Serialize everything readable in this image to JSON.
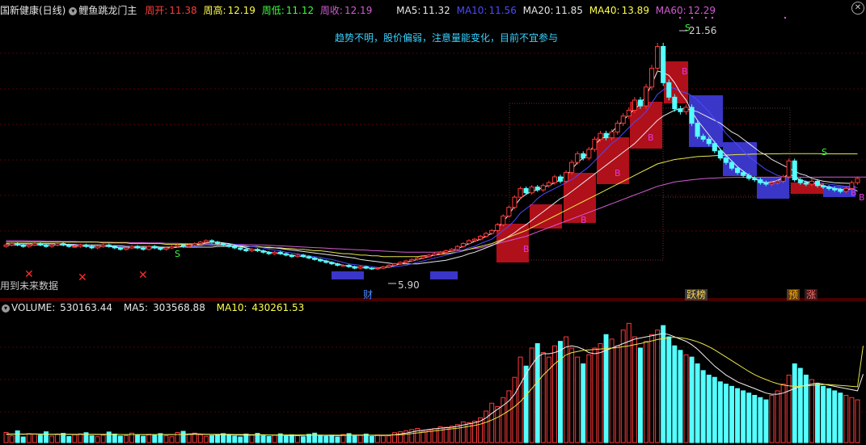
{
  "header": {
    "title": "国新健康(日线)",
    "indicator_name": "鲤鱼跳龙门主",
    "stats": [
      {
        "label": "周开:",
        "value": "11.38",
        "color": "#ff3a3a"
      },
      {
        "label": "周高:",
        "value": "12.19",
        "color": "#ffff4a"
      },
      {
        "label": "周低:",
        "value": "11.12",
        "color": "#3aff3a"
      },
      {
        "label": "周收:",
        "value": "12.19",
        "color": "#d35bd3"
      }
    ],
    "ma": [
      {
        "label": "MA5:",
        "value": "11.32",
        "color": "#e6e6e6"
      },
      {
        "label": "MA10:",
        "value": "11.56",
        "color": "#4a4aff"
      },
      {
        "label": "MA20:",
        "value": "11.85",
        "color": "#e6e6e6"
      },
      {
        "label": "MA40:",
        "value": "13.89",
        "color": "#ffff4a"
      },
      {
        "label": "MA60:",
        "value": "12.29",
        "color": "#d35bd3"
      }
    ]
  },
  "notes": {
    "advice": "趋势不明，股价偏弱，注意量能变化，目前不宜参与",
    "future_data": "用到未来数据",
    "high_label": "21.56",
    "low_label": "5.90"
  },
  "events": [
    {
      "text": "财",
      "color": "#4a8cff",
      "bg": "#2a2a2a"
    },
    {
      "text": "跃榜",
      "color": "#ffd24a",
      "bg": "#3a3a3a"
    },
    {
      "text": "预",
      "color": "#ffb400",
      "bg": "#5a3a1a"
    },
    {
      "text": "涨",
      "color": "#ff6a6a",
      "bg": "#3a1a1a"
    }
  ],
  "volume_header": {
    "label": "VOLUME:",
    "value": "530163.44",
    "ma5_label": "MA5:",
    "ma5_value": "303568.88",
    "ma10_label": "MA10:",
    "ma10_value": "430261.53"
  },
  "chart_data": {
    "type": "candlestick",
    "price_high": 21.56,
    "price_low": 5.9,
    "closes": [
      7.6,
      7.7,
      7.6,
      7.5,
      7.6,
      7.7,
      7.6,
      7.5,
      7.6,
      7.7,
      7.6,
      7.5,
      7.5,
      7.6,
      7.5,
      7.4,
      7.5,
      7.6,
      7.5,
      7.4,
      7.3,
      7.4,
      7.5,
      7.4,
      7.3,
      7.5,
      7.4,
      7.3,
      7.4,
      7.5,
      7.6,
      7.5,
      7.6,
      7.7,
      7.8,
      7.9,
      7.8,
      7.7,
      7.6,
      7.5,
      7.4,
      7.3,
      7.2,
      7.3,
      7.2,
      7.1,
      7.0,
      7.1,
      7.0,
      6.9,
      6.8,
      6.9,
      6.8,
      6.7,
      6.6,
      6.5,
      6.4,
      6.3,
      6.2,
      6.2,
      6.1,
      6.0,
      6.1,
      6.0,
      5.95,
      6.0,
      6.1,
      6.2,
      6.3,
      6.4,
      6.5,
      6.6,
      6.7,
      6.8,
      6.9,
      7.0,
      7.1,
      7.2,
      7.3,
      7.5,
      7.7,
      7.9,
      8.0,
      8.2,
      8.4,
      8.6,
      9.0,
      9.6,
      10.2,
      10.9,
      11.5,
      11.2,
      11.6,
      11.4,
      11.7,
      11.9,
      12.3,
      12.0,
      12.6,
      13.3,
      13.9,
      13.6,
      14.2,
      14.9,
      15.3,
      15.0,
      15.4,
      16.0,
      16.5,
      16.9,
      17.6,
      17.2,
      18.5,
      19.8,
      21.3,
      18.8,
      17.8,
      17.0,
      16.8,
      17.1,
      16.0,
      15.1,
      14.9,
      14.6,
      14.1,
      13.6,
      13.3,
      12.9,
      12.6,
      12.4,
      12.2,
      12.1,
      11.9,
      11.8,
      11.9,
      12.0,
      12.3,
      13.4,
      12.1,
      11.9,
      11.8,
      12.0,
      11.7,
      11.6,
      11.5,
      11.4,
      11.3,
      11.5,
      11.9,
      12.19
    ],
    "opens": [
      7.5,
      7.6,
      7.7,
      7.6,
      7.5,
      7.6,
      7.7,
      7.6,
      7.5,
      7.6,
      7.7,
      7.6,
      7.5,
      7.5,
      7.6,
      7.5,
      7.4,
      7.5,
      7.6,
      7.5,
      7.4,
      7.3,
      7.4,
      7.5,
      7.4,
      7.3,
      7.5,
      7.4,
      7.3,
      7.4,
      7.5,
      7.6,
      7.5,
      7.6,
      7.7,
      7.8,
      7.9,
      7.8,
      7.7,
      7.6,
      7.5,
      7.4,
      7.3,
      7.2,
      7.3,
      7.2,
      7.1,
      7.0,
      7.1,
      7.0,
      6.9,
      6.8,
      6.9,
      6.8,
      6.7,
      6.6,
      6.5,
      6.4,
      6.3,
      6.2,
      6.2,
      6.1,
      6.0,
      6.1,
      6.0,
      5.95,
      6.0,
      6.1,
      6.2,
      6.3,
      6.4,
      6.5,
      6.6,
      6.7,
      6.8,
      6.9,
      7.0,
      7.1,
      7.2,
      7.3,
      7.5,
      7.7,
      7.9,
      8.0,
      8.2,
      8.4,
      8.6,
      9.0,
      9.6,
      10.2,
      10.9,
      11.5,
      11.2,
      11.6,
      11.4,
      11.7,
      11.9,
      12.3,
      12.0,
      12.6,
      13.3,
      13.9,
      13.6,
      14.2,
      14.9,
      15.3,
      15.0,
      15.4,
      16.0,
      16.5,
      16.9,
      17.6,
      17.2,
      18.5,
      19.8,
      21.3,
      18.8,
      17.8,
      17.0,
      16.8,
      17.1,
      16.0,
      15.1,
      14.9,
      14.6,
      14.1,
      13.6,
      13.3,
      12.9,
      12.6,
      12.4,
      12.2,
      12.1,
      11.9,
      11.8,
      11.9,
      12.0,
      12.3,
      13.4,
      12.1,
      11.9,
      11.8,
      12.0,
      11.7,
      11.6,
      11.5,
      11.4,
      11.3,
      11.5,
      11.9
    ],
    "ma5": [
      7.6,
      7.6,
      7.6,
      7.6,
      7.6,
      7.6,
      7.6,
      7.6,
      7.6,
      7.6,
      7.6,
      7.6,
      7.55,
      7.55,
      7.5,
      7.5,
      7.5,
      7.5,
      7.5,
      7.45,
      7.4,
      7.4,
      7.4,
      7.4,
      7.4,
      7.4,
      7.4,
      7.4,
      7.4,
      7.4,
      7.45,
      7.5,
      7.55,
      7.6,
      7.7,
      7.75,
      7.8,
      7.8,
      7.75,
      7.7,
      7.6,
      7.5,
      7.4,
      7.3,
      7.25,
      7.2,
      7.1,
      7.05,
      7.0,
      6.95,
      6.9,
      6.85,
      6.8,
      6.75,
      6.7,
      6.6,
      6.5,
      6.4,
      6.3,
      6.2,
      6.15,
      6.1,
      6.05,
      6.05,
      6.0,
      6.0,
      6.05,
      6.1,
      6.2,
      6.3,
      6.4,
      6.5,
      6.6,
      6.7,
      6.8,
      6.9,
      7.0,
      7.1,
      7.2,
      7.35,
      7.5,
      7.7,
      7.85,
      8.0,
      8.2,
      8.4,
      8.75,
      9.2,
      9.7,
      10.3,
      10.8,
      11.1,
      11.3,
      11.4,
      11.6,
      11.7,
      11.9,
      12.1,
      12.4,
      12.8,
      13.3,
      13.6,
      14.0,
      14.5,
      14.9,
      15.1,
      15.4,
      15.8,
      16.2,
      16.6,
      17.0,
      17.3,
      17.9,
      18.7,
      19.6,
      19.5,
      19.3,
      18.8,
      18.1,
      17.6,
      16.8,
      16.2,
      15.7,
      15.2,
      14.7,
      14.2,
      13.8,
      13.4,
      13.0,
      12.7,
      12.4,
      12.2,
      12.0,
      11.9,
      11.95,
      12.05,
      12.25,
      12.5,
      12.3,
      12.1,
      11.95,
      11.9,
      11.8,
      11.7,
      11.6,
      11.5,
      11.45,
      11.4,
      11.5,
      11.32
    ],
    "ma10": [
      7.6,
      7.6,
      7.6,
      7.6,
      7.6,
      7.6,
      7.6,
      7.6,
      7.6,
      7.6,
      7.6,
      7.6,
      7.6,
      7.6,
      7.55,
      7.55,
      7.5,
      7.5,
      7.5,
      7.5,
      7.45,
      7.45,
      7.45,
      7.4,
      7.4,
      7.4,
      7.4,
      7.4,
      7.4,
      7.4,
      7.45,
      7.45,
      7.5,
      7.5,
      7.55,
      7.6,
      7.65,
      7.7,
      7.7,
      7.7,
      7.65,
      7.6,
      7.55,
      7.5,
      7.45,
      7.4,
      7.3,
      7.25,
      7.2,
      7.1,
      7.05,
      7.0,
      6.9,
      6.85,
      6.8,
      6.75,
      6.65,
      6.6,
      6.5,
      6.4,
      6.3,
      6.25,
      6.2,
      6.15,
      6.1,
      6.05,
      6.05,
      6.05,
      6.1,
      6.15,
      6.2,
      6.3,
      6.4,
      6.5,
      6.6,
      6.7,
      6.8,
      6.9,
      7.0,
      7.1,
      7.25,
      7.4,
      7.5,
      7.7,
      7.85,
      8.0,
      8.3,
      8.6,
      8.9,
      9.3,
      9.8,
      10.1,
      10.4,
      10.8,
      11.1,
      11.3,
      11.5,
      11.7,
      11.9,
      12.1,
      12.4,
      12.7,
      13.0,
      13.4,
      13.8,
      14.2,
      14.6,
      14.9,
      15.3,
      15.7,
      16.1,
      16.4,
      16.8,
      17.4,
      18.0,
      18.3,
      18.5,
      18.4,
      18.2,
      18.1,
      17.9,
      17.6,
      17.2,
      16.8,
      16.3,
      15.8,
      15.3,
      14.9,
      14.5,
      14.1,
      13.7,
      13.4,
      13.1,
      12.8,
      12.6,
      12.4,
      12.3,
      12.3,
      12.2,
      12.1,
      12.0,
      11.95,
      11.9,
      11.85,
      11.8,
      11.75,
      11.7,
      11.65,
      11.6,
      11.56
    ],
    "ma20": [
      7.7,
      7.7,
      7.7,
      7.7,
      7.7,
      7.7,
      7.7,
      7.7,
      7.7,
      7.7,
      7.65,
      7.65,
      7.65,
      7.6,
      7.6,
      7.6,
      7.6,
      7.6,
      7.55,
      7.55,
      7.55,
      7.5,
      7.5,
      7.5,
      7.5,
      7.5,
      7.5,
      7.45,
      7.45,
      7.45,
      7.45,
      7.45,
      7.45,
      7.45,
      7.45,
      7.45,
      7.45,
      7.5,
      7.5,
      7.5,
      7.5,
      7.5,
      7.5,
      7.5,
      7.45,
      7.45,
      7.4,
      7.4,
      7.35,
      7.3,
      7.25,
      7.2,
      7.15,
      7.1,
      7.05,
      7.0,
      6.95,
      6.9,
      6.85,
      6.8,
      6.75,
      6.7,
      6.6,
      6.55,
      6.5,
      6.45,
      6.4,
      6.35,
      6.3,
      6.3,
      6.3,
      6.3,
      6.3,
      6.35,
      6.4,
      6.45,
      6.5,
      6.55,
      6.65,
      6.75,
      6.85,
      7.0,
      7.1,
      7.25,
      7.4,
      7.55,
      7.75,
      7.95,
      8.2,
      8.45,
      8.75,
      9.0,
      9.3,
      9.6,
      9.9,
      10.2,
      10.5,
      10.8,
      11.0,
      11.3,
      11.6,
      11.9,
      12.2,
      12.5,
      12.8,
      13.1,
      13.4,
      13.7,
      14.0,
      14.3,
      14.6,
      15.0,
      15.4,
      15.8,
      16.2,
      16.5,
      16.7,
      16.9,
      17.0,
      17.0,
      16.9,
      16.8,
      16.6,
      16.4,
      16.2,
      16.0,
      15.7,
      15.4,
      15.2,
      14.9,
      14.6,
      14.3,
      14.0,
      13.8,
      13.5,
      13.3,
      13.1,
      12.9,
      12.7,
      12.5,
      12.4,
      12.2,
      12.1,
      12.0,
      11.95,
      11.9,
      11.88,
      11.86,
      11.85
    ],
    "ma40": [
      7.8,
      7.8,
      7.8,
      7.8,
      7.8,
      7.8,
      7.8,
      7.8,
      7.8,
      7.8,
      7.8,
      7.8,
      7.8,
      7.8,
      7.8,
      7.8,
      7.8,
      7.75,
      7.75,
      7.75,
      7.75,
      7.75,
      7.7,
      7.7,
      7.7,
      7.7,
      7.7,
      7.7,
      7.65,
      7.65,
      7.65,
      7.65,
      7.65,
      7.6,
      7.6,
      7.6,
      7.6,
      7.6,
      7.6,
      7.55,
      7.55,
      7.55,
      7.5,
      7.5,
      7.5,
      7.45,
      7.45,
      7.4,
      7.4,
      7.35,
      7.35,
      7.3,
      7.3,
      7.25,
      7.2,
      7.2,
      7.15,
      7.1,
      7.05,
      7.0,
      7.0,
      6.95,
      6.9,
      6.9,
      6.85,
      6.85,
      6.8,
      6.8,
      6.8,
      6.8,
      6.8,
      6.8,
      6.8,
      6.85,
      6.85,
      6.9,
      6.95,
      7.0,
      7.05,
      7.1,
      7.2,
      7.3,
      7.4,
      7.5,
      7.6,
      7.7,
      7.85,
      8.0,
      8.15,
      8.3,
      8.45,
      8.6,
      8.8,
      9.0,
      9.2,
      9.4,
      9.6,
      9.8,
      10.0,
      10.2,
      10.4,
      10.6,
      10.8,
      11.0,
      11.2,
      11.4,
      11.6,
      11.8,
      12.0,
      12.2,
      12.4,
      12.6,
      12.8,
      13.0,
      13.2,
      13.3,
      13.4,
      13.5,
      13.55,
      13.6,
      13.65,
      13.7,
      13.72,
      13.74,
      13.76,
      13.78,
      13.8,
      13.82,
      13.84,
      13.85,
      13.86,
      13.87,
      13.88,
      13.89,
      13.89,
      13.89,
      13.9,
      13.9,
      13.9,
      13.9,
      13.9,
      13.9,
      13.9,
      13.89,
      13.89,
      13.89,
      13.89,
      13.89,
      13.89,
      13.89
    ],
    "ma60": [
      7.9,
      7.9,
      7.9,
      7.9,
      7.88,
      7.88,
      7.88,
      7.86,
      7.86,
      7.86,
      7.84,
      7.84,
      7.84,
      7.82,
      7.82,
      7.82,
      7.8,
      7.8,
      7.8,
      7.78,
      7.78,
      7.78,
      7.76,
      7.76,
      7.76,
      7.74,
      7.74,
      7.74,
      7.72,
      7.72,
      7.72,
      7.7,
      7.7,
      7.7,
      7.68,
      7.68,
      7.68,
      7.66,
      7.66,
      7.66,
      7.64,
      7.64,
      7.62,
      7.62,
      7.6,
      7.6,
      7.58,
      7.56,
      7.54,
      7.52,
      7.5,
      7.48,
      7.46,
      7.44,
      7.42,
      7.4,
      7.38,
      7.36,
      7.34,
      7.32,
      7.3,
      7.28,
      7.26,
      7.24,
      7.22,
      7.2,
      7.18,
      7.16,
      7.14,
      7.12,
      7.1,
      7.1,
      7.1,
      7.1,
      7.1,
      7.1,
      7.12,
      7.14,
      7.16,
      7.2,
      7.25,
      7.3,
      7.35,
      7.4,
      7.5,
      7.6,
      7.7,
      7.8,
      7.9,
      8.0,
      8.1,
      8.2,
      8.35,
      8.5,
      8.65,
      8.8,
      8.95,
      9.1,
      9.25,
      9.4,
      9.55,
      9.7,
      9.85,
      10.0,
      10.15,
      10.3,
      10.45,
      10.6,
      10.75,
      10.9,
      11.05,
      11.2,
      11.35,
      11.5,
      11.65,
      11.75,
      11.85,
      11.95,
      12.0,
      12.05,
      12.1,
      12.14,
      12.17,
      12.2,
      12.22,
      12.24,
      12.25,
      12.26,
      12.27,
      12.27,
      12.28,
      12.28,
      12.28,
      12.28,
      12.28,
      12.28,
      12.28,
      12.28,
      12.28,
      12.28,
      12.28,
      12.28,
      12.28,
      12.29,
      12.29,
      12.29,
      12.29,
      12.29,
      12.29,
      12.29,
      12.29,
      12.29
    ],
    "volume": [
      45,
      30,
      52,
      25,
      40,
      38,
      33,
      48,
      29,
      36,
      41,
      27,
      35,
      39,
      44,
      30,
      26,
      33,
      47,
      38,
      29,
      31,
      42,
      35,
      28,
      37,
      33,
      40,
      30,
      26,
      45,
      50,
      38,
      42,
      35,
      28,
      31,
      36,
      40,
      33,
      29,
      25,
      38,
      34,
      41,
      30,
      27,
      33,
      39,
      28,
      35,
      31,
      26,
      37,
      42,
      30,
      28,
      33,
      25,
      36,
      40,
      29,
      32,
      38,
      27,
      34,
      31,
      30,
      44,
      48,
      52,
      58,
      63,
      50,
      55,
      62,
      70,
      68,
      73,
      80,
      92,
      88,
      95,
      110,
      140,
      175,
      160,
      200,
      230,
      290,
      380,
      340,
      420,
      440,
      400,
      380,
      430,
      450,
      470,
      420,
      380,
      350,
      390,
      420,
      440,
      480,
      460,
      430,
      500,
      530,
      470,
      420,
      450,
      480,
      500,
      520,
      470,
      430,
      410,
      390,
      380,
      350,
      320,
      300,
      290,
      270,
      260,
      250,
      240,
      230,
      220,
      210,
      200,
      190,
      210,
      230,
      260,
      300,
      350,
      330,
      300,
      280,
      260,
      250,
      240,
      230,
      220,
      210,
      200,
      190,
      210
    ],
    "volume_ma5": [
      37,
      37,
      38,
      37,
      38,
      38,
      37,
      37,
      37,
      38,
      37,
      37,
      36,
      37,
      37,
      37,
      36,
      36,
      37,
      37,
      36,
      35,
      36,
      36,
      35,
      35,
      36,
      36,
      35,
      35,
      36,
      37,
      38,
      39,
      38,
      37,
      36,
      35,
      35,
      35,
      34,
      33,
      33,
      33,
      34,
      34,
      33,
      33,
      33,
      32,
      32,
      32,
      32,
      33,
      33,
      33,
      32,
      32,
      31,
      32,
      33,
      33,
      33,
      33,
      32,
      32,
      32,
      33,
      35,
      38,
      42,
      47,
      52,
      55,
      58,
      61,
      64,
      66,
      68,
      72,
      78,
      83,
      88,
      96,
      110,
      130,
      148,
      165,
      185,
      215,
      260,
      305,
      345,
      380,
      395,
      395,
      400,
      410,
      425,
      430,
      425,
      415,
      400,
      395,
      400,
      410,
      420,
      430,
      440,
      450,
      460,
      465,
      470,
      475,
      480,
      485,
      480,
      470,
      460,
      450,
      435,
      415,
      390,
      365,
      340,
      320,
      300,
      285,
      270,
      260,
      250,
      240,
      230,
      220,
      215,
      215,
      220,
      230,
      240,
      250,
      255,
      260,
      265,
      260,
      255,
      250,
      245,
      240,
      235,
      230,
      304
    ],
    "volume_ma10": [
      38,
      38,
      38,
      38,
      38,
      38,
      38,
      38,
      37,
      37,
      37,
      37,
      37,
      37,
      37,
      37,
      37,
      37,
      37,
      36,
      36,
      36,
      36,
      36,
      36,
      36,
      36,
      36,
      36,
      36,
      36,
      36,
      36,
      37,
      37,
      37,
      37,
      37,
      37,
      37,
      36,
      36,
      36,
      35,
      35,
      35,
      34,
      34,
      34,
      34,
      34,
      34,
      34,
      33,
      33,
      33,
      33,
      33,
      33,
      33,
      33,
      33,
      33,
      33,
      33,
      33,
      33,
      33,
      34,
      35,
      37,
      40,
      43,
      46,
      49,
      52,
      55,
      58,
      61,
      64,
      68,
      72,
      76,
      82,
      90,
      100,
      112,
      126,
      142,
      160,
      182,
      210,
      240,
      270,
      300,
      325,
      350,
      370,
      390,
      400,
      405,
      410,
      412,
      414,
      416,
      418,
      420,
      422,
      426,
      430,
      435,
      440,
      446,
      452,
      458,
      462,
      466,
      468,
      466,
      462,
      456,
      448,
      438,
      426,
      412,
      396,
      380,
      364,
      348,
      332,
      316,
      302,
      290,
      280,
      270,
      262,
      256,
      252,
      250,
      250,
      252,
      254,
      256,
      258,
      258,
      256,
      254,
      252,
      250,
      248,
      430
    ]
  }
}
